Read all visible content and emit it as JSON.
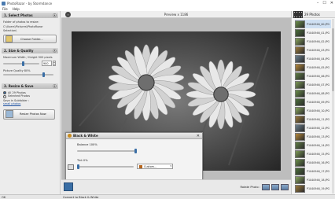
{
  "window": {
    "title": "PhotoRazor - by Stormdance",
    "min": "–",
    "max": "☐",
    "close": "✕"
  },
  "menu": [
    "File",
    "Help"
  ],
  "steps": {
    "step1": {
      "title": "1. Select Photos",
      "folder_label": "Folder of photos to resize:",
      "folder_path_1": "C:\\Users\\Pictures\\PhotoRazor",
      "folder_path_2": "Selection\\",
      "choose_button": "Choose Folder..."
    },
    "step2": {
      "title": "2. Size & Quality",
      "max_label": "Maximum Width / Height 900 pixels",
      "size_value": "900",
      "quality_label": "Picture Quality 80%",
      "size_fraction": 0.55,
      "quality_fraction": 0.8
    },
    "step3": {
      "title": "3. Resize & Save",
      "radio_all": "All 29 Photos",
      "radio_selected": "Selected Photos",
      "save_label": "Save in Subfolder :",
      "subfolder": "small photos",
      "resize_button": "Resize Photos Now"
    }
  },
  "preview": {
    "title": "Preview x 1186"
  },
  "bw_dialog": {
    "title": "Black & White",
    "balance_label": "Balance 100%",
    "tint_label": "Tint 0%",
    "tint_preset": "Custom...",
    "balance_fraction": 1.0,
    "tint_fraction": 0.0,
    "tint_swatch": "#b5651d"
  },
  "rotate": {
    "label": "Rotate Photo :"
  },
  "filmstrip": {
    "header": "29 Photos",
    "items": [
      "P1040946_00.JPG",
      "P1040946_01.JPG",
      "P1040946_02.JPG",
      "P1040946_03.JPG",
      "P1040946_04.JPG",
      "P1040946_05.JPG",
      "P1040946_06.JPG",
      "P1040946_07.JPG",
      "P1040946_08.JPG",
      "P1040946_09.JPG",
      "P1040946_10.JPG",
      "P1040946_11.JPG",
      "P1040946_12.JPG",
      "P1040946_13.JPG",
      "P1040946_14.JPG",
      "P1040946_15.JPG",
      "P1040946_16.JPG",
      "P1040946_17.JPG",
      "P1040946_18.JPG",
      "P1040946_19.JPG"
    ]
  },
  "status": {
    "left": "OK",
    "message": "Convert to Black & White"
  },
  "colors": {
    "accent": "#3a6ea5",
    "panel": "#ececec",
    "dialog_icon": "#c98b1c"
  }
}
